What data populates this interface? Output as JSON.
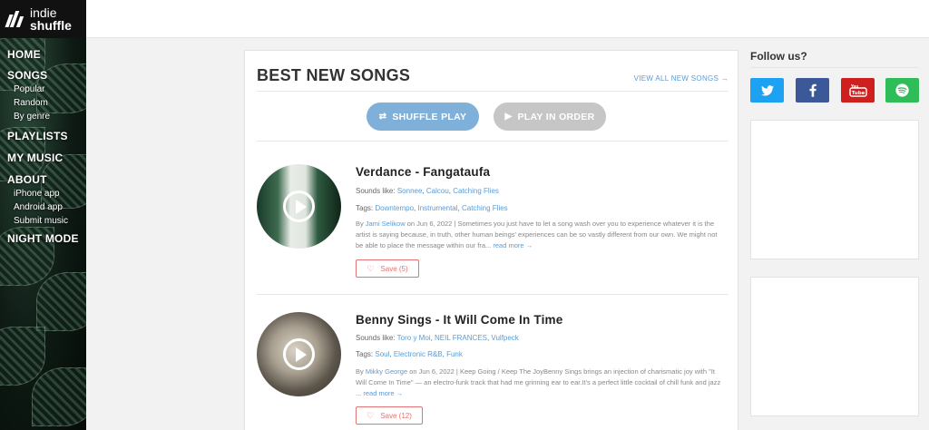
{
  "brand": {
    "line1": "indie",
    "line2": "shuffle"
  },
  "nav": {
    "home": "HOME",
    "songs": "SONGS",
    "songs_sub": [
      "Popular",
      "Random",
      "By genre"
    ],
    "playlists": "PLAYLISTS",
    "my_music": "MY MUSIC",
    "about": "ABOUT",
    "about_sub": [
      "iPhone app",
      "Android app",
      "Submit music"
    ],
    "night_mode": "NIGHT MODE"
  },
  "main": {
    "title": "BEST NEW SONGS",
    "view_all": "VIEW ALL NEW SONGS →",
    "shuffle_label": "SHUFFLE PLAY",
    "order_label": "PLAY IN ORDER"
  },
  "songs": [
    {
      "title": "Verdance - Fangataufa",
      "sounds_like_label": "Sounds like:",
      "sounds_like": [
        "Sonnee",
        "Calcou",
        "Catching Flies"
      ],
      "tags_label": "Tags:",
      "tags": [
        "Downtempo",
        "Instrumental",
        "Catching Flies"
      ],
      "by": "By",
      "author": "Jami Selikow",
      "date": "on Jun 6, 2022 | Sometimes you just have to let a song wash over you to experience whatever it is the artist is saying because, in truth, other human beings' experiences can be so vastly different from our own. We might not be able to place the message within our fra...",
      "read_more": "read more →",
      "save_label": "Save",
      "save_count": "(5)"
    },
    {
      "title": "Benny Sings - It Will Come In Time",
      "sounds_like_label": "Sounds like:",
      "sounds_like": [
        "Toro y Moi",
        "NEIL FRANCES",
        "Vulfpeck"
      ],
      "tags_label": "Tags:",
      "tags": [
        "Soul",
        "Electronic R&B",
        "Funk"
      ],
      "by": "By",
      "author": "Mikky George",
      "date": "on Jun 6, 2022 | Keep Going / Keep The JoyBenny Sings brings an injection of charismatic joy with \"It Will Come In Time\" — an electro-funk track that had me grinning ear to ear.It's a perfect little cocktail of chill funk and jazz ...",
      "read_more": "read more →",
      "save_label": "Save",
      "save_count": "(12)"
    }
  ],
  "right": {
    "follow_title": "Follow us?",
    "social": [
      {
        "name": "twitter",
        "color": "#1da1f2"
      },
      {
        "name": "facebook",
        "color": "#3b5998"
      },
      {
        "name": "youtube",
        "color": "#cd201f"
      },
      {
        "name": "spotify",
        "color": "#2ebd59"
      }
    ]
  }
}
